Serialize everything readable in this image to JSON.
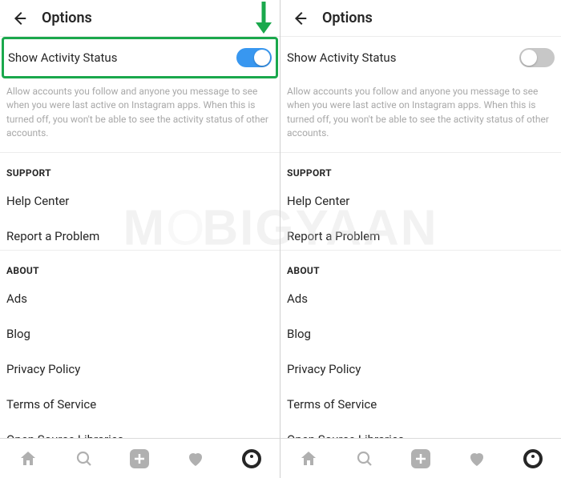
{
  "header": {
    "title": "Options"
  },
  "activity": {
    "label": "Show Activity Status",
    "description": "Allow accounts you follow and anyone you message to see when you were last active on Instagram apps. When this is turned off, you won't be able to see the activity status of other accounts."
  },
  "support": {
    "header": "SUPPORT",
    "items": [
      "Help Center",
      "Report a Problem"
    ]
  },
  "about": {
    "header": "ABOUT",
    "items": [
      "Ads",
      "Blog",
      "Privacy Policy",
      "Terms of Service",
      "Open Source Libraries"
    ]
  },
  "watermark": "MOBIGYAAN"
}
